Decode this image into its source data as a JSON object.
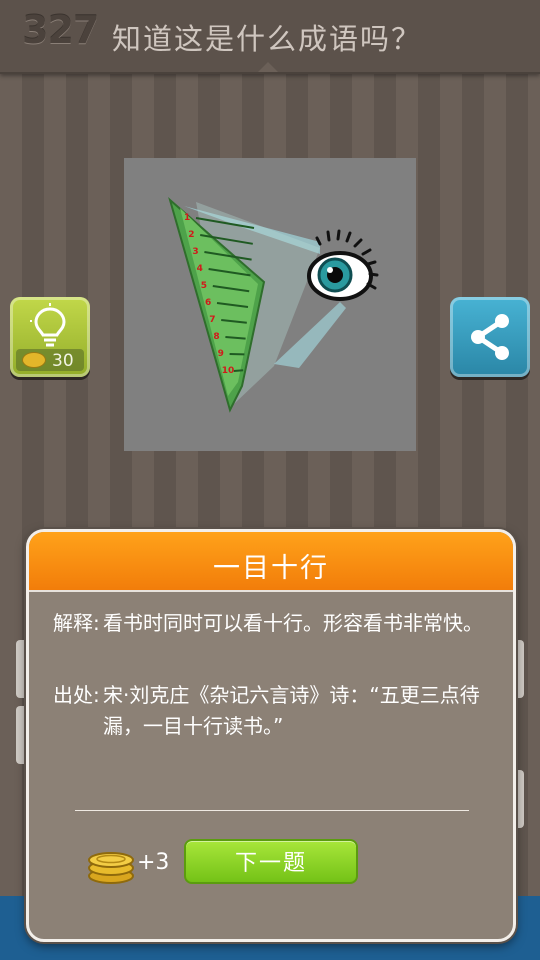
{
  "level": "327",
  "question": "知道这是什么成语吗？",
  "hint": {
    "cost": "30"
  },
  "answer_dialog": {
    "title": "一目十行",
    "explanation_label": "解释:",
    "explanation": "看书时同时可以看十行。形容看书非常快。",
    "source_label": "出处:",
    "source": "宋·刘克庄《杂记六言诗》诗：“五更三点待漏，一目十行读书。”",
    "reward": "+3",
    "next_label": "下一题"
  },
  "puzzle": {
    "line_numbers": [
      "1",
      "2",
      "3",
      "4",
      "5",
      "6",
      "7",
      "8",
      "9",
      "10"
    ]
  },
  "colors": {
    "header_orange": "#f58a10",
    "next_green": "#8fd42a",
    "hint_green": "#b2ca3e",
    "share_blue": "#3aa0c2"
  },
  "icons": [
    "lightbulb-icon",
    "coin-icon",
    "share-icon"
  ]
}
